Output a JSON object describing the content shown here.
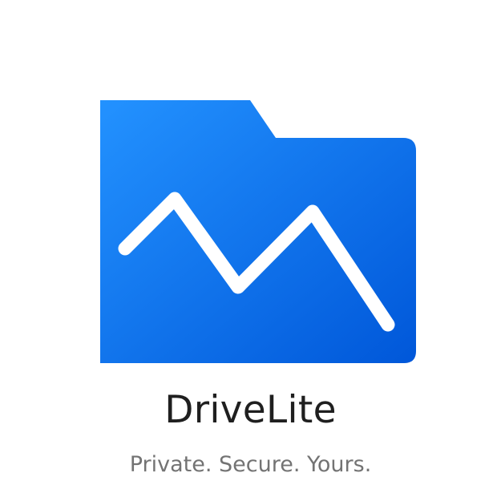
{
  "app": {
    "name": "DriveLite",
    "tagline": "Private. Secure. Yours."
  },
  "logo": {
    "icon": "folder-chart-icon",
    "folder_color_light": "#2392ff",
    "folder_color_dark": "#0057d9",
    "line_color": "#ffffff"
  },
  "text_colors": {
    "name": "#1f1f1f",
    "tagline": "#737373"
  }
}
